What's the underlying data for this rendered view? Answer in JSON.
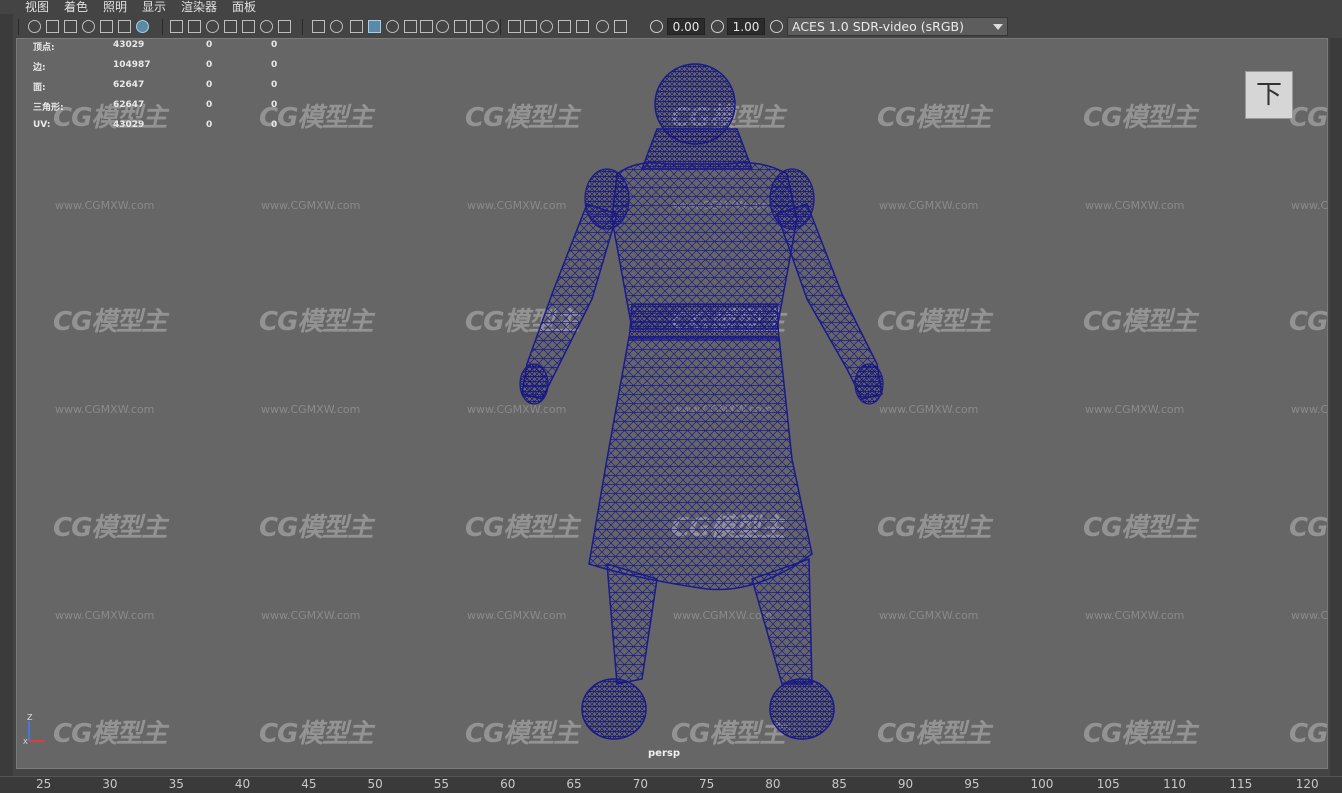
{
  "menubar": [
    "视图",
    "着色",
    "照明",
    "显示",
    "渲染器",
    "面板"
  ],
  "toolbar": {
    "icons": [
      "camera-select-icon",
      "camera-attributes-icon",
      "bookmark-icon",
      "image-plane-icon",
      "grid-lock-icon",
      "pan-icon",
      "grease-pencil-icon",
      "grid-icon",
      "film-gate-icon",
      "resolution-gate-icon",
      "gate-mask-icon",
      "field-chart-icon",
      "safe-action-icon",
      "safe-title-icon",
      "wireframe-icon",
      "smooth-shade-icon",
      "default-material-icon",
      "wireframe-on-shaded-icon",
      "textured-icon",
      "use-lights-icon",
      "shadows-icon",
      "screen-space-ao-icon",
      "motion-blur-icon",
      "multisample-aa-icon",
      "depth-of-field-icon",
      "isolate-select-icon",
      "xray-icon",
      "xray-joints-icon",
      "backface-icon",
      "exposure-icon",
      "gamma-icon",
      "color-management-icon"
    ],
    "exposure_value": "0.00",
    "gamma_value": "1.00",
    "color_space": "ACES 1.0 SDR-video (sRGB)"
  },
  "hud": {
    "rows": [
      {
        "label": "顶点:",
        "v1": "43029",
        "v2": "0",
        "v3": "0"
      },
      {
        "label": "边:",
        "v1": "104987",
        "v2": "0",
        "v3": "0"
      },
      {
        "label": "面:",
        "v1": "62647",
        "v2": "0",
        "v3": "0"
      },
      {
        "label": "三角形:",
        "v1": "62647",
        "v2": "0",
        "v3": "0"
      },
      {
        "label": "UV:",
        "v1": "43029",
        "v2": "0",
        "v3": "0"
      }
    ]
  },
  "viewport": {
    "camera_label": "persp",
    "view_cube_label": "下",
    "axis": {
      "z": "Z",
      "x": "X"
    },
    "watermark_logo": "CG模型主",
    "watermark_url": "www.CGMXW.com",
    "wireframe_color": "#1a1a8c",
    "background_color": "#666666"
  },
  "timeline": {
    "ticks": [
      "25",
      "30",
      "35",
      "40",
      "45",
      "50",
      "55",
      "60",
      "65",
      "70",
      "75",
      "80",
      "85",
      "90",
      "95",
      "100",
      "105",
      "110",
      "115",
      "120"
    ]
  }
}
